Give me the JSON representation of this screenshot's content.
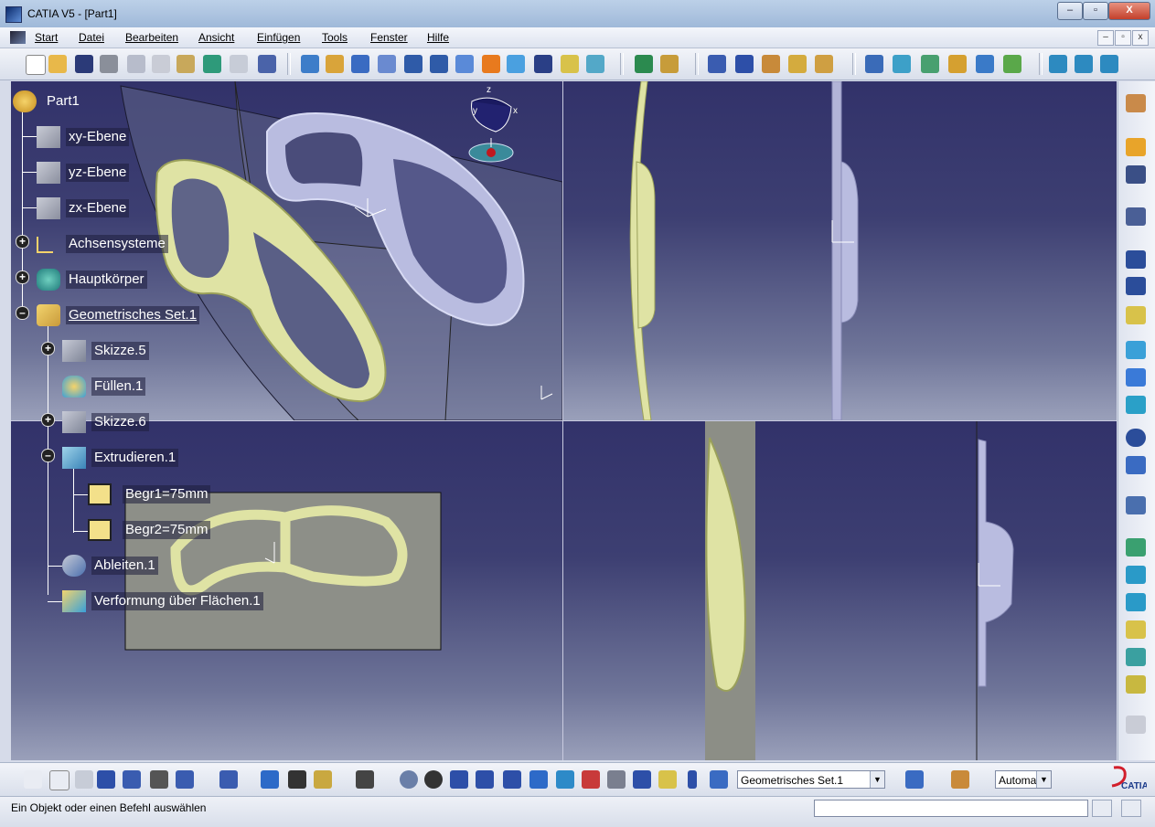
{
  "window": {
    "title": "CATIA V5 - [Part1]",
    "buttons": {
      "minimize": "–",
      "restore": "▫",
      "close": "X"
    }
  },
  "menubar": {
    "items": [
      "Start",
      "Datei",
      "Bearbeiten",
      "Ansicht",
      "Einfügen",
      "Tools",
      "Fenster",
      "Hilfe"
    ],
    "mdi": {
      "minimize": "–",
      "restore": "▫",
      "close": "x"
    }
  },
  "tree": {
    "root": "Part1",
    "items": [
      {
        "label": "xy-Ebene",
        "icon": "plane-icon"
      },
      {
        "label": "yz-Ebene",
        "icon": "plane-icon"
      },
      {
        "label": "zx-Ebene",
        "icon": "plane-icon"
      },
      {
        "label": "Achsensysteme",
        "icon": "axis-system-icon"
      },
      {
        "label": "Hauptkörper",
        "icon": "body-icon"
      },
      {
        "label": "Geometrisches Set.1",
        "icon": "geometrical-set-icon"
      },
      {
        "label": "Skizze.5",
        "icon": "sketch-icon"
      },
      {
        "label": "Füllen.1",
        "icon": "fill-icon"
      },
      {
        "label": "Skizze.6",
        "icon": "sketch-icon"
      },
      {
        "label": "Extrudieren.1",
        "icon": "extrude-icon"
      },
      {
        "label": "Begr1=75mm",
        "icon": "limit-icon"
      },
      {
        "label": "Begr2=75mm",
        "icon": "limit-icon"
      },
      {
        "label": "Ableiten.1",
        "icon": "extract-icon"
      },
      {
        "label": "Verformung über Flächen.1",
        "icon": "wrap-surface-icon"
      }
    ]
  },
  "compass": {
    "x": "x",
    "y": "y",
    "z": "z"
  },
  "bottom_toolbar": {
    "current_set": "Geometrisches Set.1",
    "mode": "Automa"
  },
  "status": {
    "message": "Ein Objekt oder einen Befehl auswählen"
  },
  "logo": {
    "text": "CATIA"
  },
  "colors": {
    "part_fill": "#dfe3a4",
    "part_stroke": "#9aa05a",
    "ghost_part": "#b9bce0",
    "viewport_top": "#32326a",
    "viewport_bottom": "#9aa0ba"
  }
}
